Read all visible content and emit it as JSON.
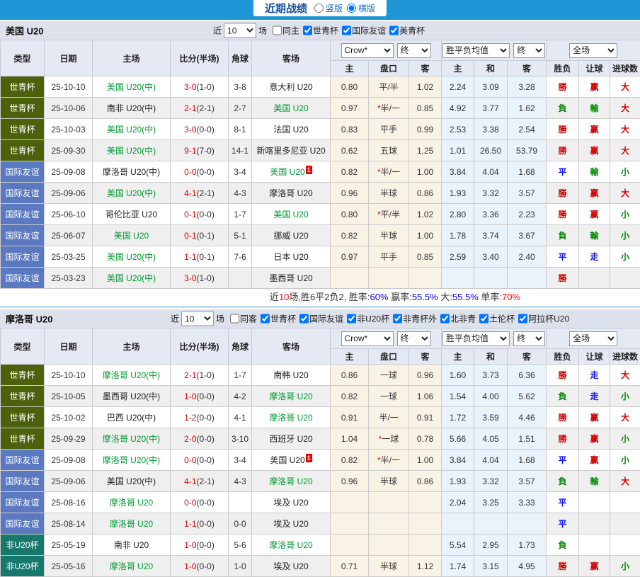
{
  "top_bar": {
    "title": "近期战绩",
    "radios": [
      {
        "label": "竖版",
        "selected": false
      },
      {
        "label": "横版",
        "selected": true
      }
    ]
  },
  "columns": {
    "type": "类型",
    "date": "日期",
    "home": "主场",
    "score": "比分(半场)",
    "corner": "角球",
    "away": "客场",
    "o_home": "主",
    "handicap": "盘口",
    "o_away": "客",
    "win": "主",
    "draw": "和",
    "lose": "客",
    "result": "胜负",
    "hcp_result": "让球",
    "goals": "进球数"
  },
  "odds_selects": {
    "bookmaker": "Crow*",
    "final_a": "终",
    "avg": "胜平负均值",
    "final_b": "终",
    "scope": "全场"
  },
  "colors": {
    "topbar_blue": "#1c96d4",
    "worldcup_green": "#4c610b",
    "friendly_blue": "#5b79c0",
    "nonu20_teal": "#17796d",
    "team_green": "#009933",
    "score_red": "#e80000",
    "win_red": "#d40000",
    "lose_green": "#008800",
    "draw_blue": "#1212ee"
  },
  "sections": [
    {
      "team": "美国 U20",
      "filter": {
        "near": "近",
        "count": "10",
        "unit": "场",
        "same": "同主",
        "cups": [
          "世青杯",
          "国际友谊",
          "美青杯"
        ]
      },
      "rows": [
        {
          "t": "世青杯",
          "tc": "wc",
          "dt": "25-10-10",
          "hm": "美国 U20(中)",
          "hg": true,
          "hsup": "",
          "ft": "3-0",
          "ht": "(1-0)",
          "cn": "3-8",
          "aw": "意大利 U20",
          "ag": false,
          "asup": "",
          "o1": "0.80",
          "hcp": "平/半",
          "o2": "1.02",
          "w": "2.24",
          "d": "3.09",
          "l": "3.28",
          "rs": "勝",
          "rsc": "r",
          "hr": "赢",
          "hrc": "r",
          "gl": "大",
          "glc": "r"
        },
        {
          "t": "世青杯",
          "tc": "wc",
          "dt": "25-10-06",
          "hm": "南非 U20(中)",
          "hg": false,
          "hsup": "",
          "ft": "2-1",
          "ht": "(2-1)",
          "cn": "2-7",
          "aw": "美国 U20",
          "ag": true,
          "asup": "",
          "o1": "0.97",
          "hcp": "*半/一",
          "o2": "0.85",
          "w": "4.92",
          "d": "3.77",
          "l": "1.62",
          "rs": "負",
          "rsc": "g",
          "hr": "輸",
          "hrc": "g",
          "gl": "大",
          "glc": "r"
        },
        {
          "t": "世青杯",
          "tc": "wc",
          "dt": "25-10-03",
          "hm": "美国 U20(中)",
          "hg": true,
          "hsup": "",
          "ft": "3-0",
          "ht": "(0-0)",
          "cn": "8-1",
          "aw": "法国 U20",
          "ag": false,
          "asup": "",
          "o1": "0.83",
          "hcp": "平手",
          "o2": "0.99",
          "w": "2.53",
          "d": "3.38",
          "l": "2.54",
          "rs": "勝",
          "rsc": "r",
          "hr": "赢",
          "hrc": "r",
          "gl": "大",
          "glc": "r"
        },
        {
          "t": "世青杯",
          "tc": "wc",
          "dt": "25-09-30",
          "hm": "美国 U20(中)",
          "hg": true,
          "hsup": "",
          "ft": "9-1",
          "ht": "(7-0)",
          "cn": "14-1",
          "aw": "新喀里多尼亚 U20",
          "ag": false,
          "asup": "",
          "o1": "0.62",
          "hcp": "五球",
          "o2": "1.25",
          "w": "1.01",
          "d": "26.50",
          "l": "53.79",
          "rs": "勝",
          "rsc": "r",
          "hr": "赢",
          "hrc": "r",
          "gl": "大",
          "glc": "r"
        },
        {
          "t": "国际友谊",
          "tc": "fr",
          "dt": "25-09-08",
          "hm": "摩洛哥 U20(中)",
          "hg": false,
          "hsup": "",
          "ft": "0-0",
          "ht": "(0-0)",
          "cn": "3-4",
          "aw": "美国 U20",
          "ag": true,
          "asup": "1",
          "o1": "0.82",
          "hcp": "*半/一",
          "o2": "1.00",
          "w": "3.84",
          "d": "4.04",
          "l": "1.68",
          "rs": "平",
          "rsc": "b",
          "hr": "輸",
          "hrc": "g",
          "gl": "小",
          "glc": "g"
        },
        {
          "t": "国际友谊",
          "tc": "fr",
          "dt": "25-09-06",
          "hm": "美国 U20(中)",
          "hg": true,
          "hsup": "",
          "ft": "4-1",
          "ht": "(2-1)",
          "cn": "4-3",
          "aw": "摩洛哥 U20",
          "ag": false,
          "asup": "",
          "o1": "0.96",
          "hcp": "半球",
          "o2": "0.86",
          "w": "1.93",
          "d": "3.32",
          "l": "3.57",
          "rs": "勝",
          "rsc": "r",
          "hr": "赢",
          "hrc": "r",
          "gl": "大",
          "glc": "r"
        },
        {
          "t": "国际友谊",
          "tc": "fr",
          "dt": "25-06-10",
          "hm": "哥伦比亚 U20",
          "hg": false,
          "hsup": "",
          "ft": "0-1",
          "ht": "(0-0)",
          "cn": "1-7",
          "aw": "美国 U20",
          "ag": true,
          "asup": "",
          "o1": "0.80",
          "hcp": "*平/半",
          "o2": "1.02",
          "w": "2.80",
          "d": "3.36",
          "l": "2.23",
          "rs": "勝",
          "rsc": "r",
          "hr": "赢",
          "hrc": "r",
          "gl": "小",
          "glc": "g"
        },
        {
          "t": "国际友谊",
          "tc": "fr",
          "dt": "25-06-07",
          "hm": "美国 U20",
          "hg": true,
          "hsup": "",
          "ft": "0-1",
          "ht": "(0-1)",
          "cn": "5-1",
          "aw": "挪威 U20",
          "ag": false,
          "asup": "",
          "o1": "0.82",
          "hcp": "半球",
          "o2": "1.00",
          "w": "1.78",
          "d": "3.74",
          "l": "3.67",
          "rs": "負",
          "rsc": "g",
          "hr": "輸",
          "hrc": "g",
          "gl": "小",
          "glc": "g"
        },
        {
          "t": "国际友谊",
          "tc": "fr",
          "dt": "25-03-25",
          "hm": "美国 U20(中)",
          "hg": true,
          "hsup": "",
          "ft": "1-1",
          "ht": "(0-1)",
          "cn": "7-6",
          "aw": "日本 U20",
          "ag": false,
          "asup": "",
          "o1": "0.97",
          "hcp": "平手",
          "o2": "0.85",
          "w": "2.59",
          "d": "3.40",
          "l": "2.40",
          "rs": "平",
          "rsc": "b",
          "hr": "走",
          "hrc": "b",
          "gl": "小",
          "glc": "g"
        },
        {
          "t": "国际友谊",
          "tc": "fr",
          "dt": "25-03-23",
          "hm": "美国 U20(中)",
          "hg": true,
          "hsup": "",
          "ft": "3-0",
          "ht": "(1-0)",
          "cn": "",
          "aw": "墨西哥 U20",
          "ag": false,
          "asup": "",
          "o1": "",
          "hcp": "",
          "o2": "",
          "w": "",
          "d": "",
          "l": "",
          "rs": "勝",
          "rsc": "r",
          "hr": "",
          "hrc": "",
          "gl": "",
          "glc": ""
        }
      ],
      "summary": [
        {
          "t": "近",
          "c": "k"
        },
        {
          "t": "10",
          "c": "r"
        },
        {
          "t": "场,胜6平2负2, 胜率:",
          "c": "k"
        },
        {
          "t": "60%",
          "c": "b"
        },
        {
          "t": " 赢率:",
          "c": "k"
        },
        {
          "t": "55.5%",
          "c": "b"
        },
        {
          "t": " 大:",
          "c": "k"
        },
        {
          "t": "55.5%",
          "c": "b"
        },
        {
          "t": " 单率:",
          "c": "k"
        },
        {
          "t": "70%",
          "c": "r"
        }
      ]
    },
    {
      "team": "摩洛哥 U20",
      "filter": {
        "near": "近",
        "count": "10",
        "unit": "场",
        "same": "同客",
        "cups": [
          "世青杯",
          "国际友谊",
          "非U20杯",
          "非青杯外",
          "北非青",
          "土伦杯",
          "阿拉杯U20"
        ]
      },
      "rows": [
        {
          "t": "世青杯",
          "tc": "wc",
          "dt": "25-10-10",
          "hm": "摩洛哥 U20(中)",
          "hg": true,
          "hsup": "",
          "ft": "2-1",
          "ht": "(1-0)",
          "cn": "1-7",
          "aw": "南韩 U20",
          "ag": false,
          "asup": "",
          "o1": "0.86",
          "hcp": "一球",
          "o2": "0.96",
          "w": "1.60",
          "d": "3.73",
          "l": "6.36",
          "rs": "勝",
          "rsc": "r",
          "hr": "走",
          "hrc": "b",
          "gl": "大",
          "glc": "r"
        },
        {
          "t": "世青杯",
          "tc": "wc",
          "dt": "25-10-05",
          "hm": "墨西哥 U20(中)",
          "hg": false,
          "hsup": "",
          "ft": "1-0",
          "ht": "(0-0)",
          "cn": "4-2",
          "aw": "摩洛哥 U20",
          "ag": true,
          "asup": "",
          "o1": "0.82",
          "hcp": "一球",
          "o2": "1.06",
          "w": "1.54",
          "d": "4.00",
          "l": "5.62",
          "rs": "負",
          "rsc": "g",
          "hr": "走",
          "hrc": "b",
          "gl": "小",
          "glc": "g"
        },
        {
          "t": "世青杯",
          "tc": "wc",
          "dt": "25-10-02",
          "hm": "巴西 U20(中)",
          "hg": false,
          "hsup": "",
          "ft": "1-2",
          "ht": "(0-0)",
          "cn": "4-1",
          "aw": "摩洛哥 U20",
          "ag": true,
          "asup": "",
          "o1": "0.91",
          "hcp": "半/一",
          "o2": "0.91",
          "w": "1.72",
          "d": "3.59",
          "l": "4.46",
          "rs": "勝",
          "rsc": "r",
          "hr": "赢",
          "hrc": "r",
          "gl": "大",
          "glc": "r"
        },
        {
          "t": "世青杯",
          "tc": "wc",
          "dt": "25-09-29",
          "hm": "摩洛哥 U20(中)",
          "hg": true,
          "hsup": "",
          "ft": "2-0",
          "ht": "(0-0)",
          "cn": "3-10",
          "aw": "西班牙 U20",
          "ag": false,
          "asup": "",
          "o1": "1.04",
          "hcp": "*一球",
          "o2": "0.78",
          "w": "5.66",
          "d": "4.05",
          "l": "1.51",
          "rs": "勝",
          "rsc": "r",
          "hr": "赢",
          "hrc": "r",
          "gl": "小",
          "glc": "g"
        },
        {
          "t": "国际友谊",
          "tc": "fr",
          "dt": "25-09-08",
          "hm": "摩洛哥 U20(中)",
          "hg": true,
          "hsup": "",
          "ft": "0-0",
          "ht": "(0-0)",
          "cn": "3-4",
          "aw": "美国 U20",
          "ag": false,
          "asup": "1",
          "o1": "0.82",
          "hcp": "*半/一",
          "o2": "1.00",
          "w": "3.84",
          "d": "4.04",
          "l": "1.68",
          "rs": "平",
          "rsc": "b",
          "hr": "赢",
          "hrc": "r",
          "gl": "小",
          "glc": "g"
        },
        {
          "t": "国际友谊",
          "tc": "fr",
          "dt": "25-09-06",
          "hm": "美国 U20(中)",
          "hg": false,
          "hsup": "",
          "ft": "4-1",
          "ht": "(2-1)",
          "cn": "4-3",
          "aw": "摩洛哥 U20",
          "ag": true,
          "asup": "",
          "o1": "0.96",
          "hcp": "半球",
          "o2": "0.86",
          "w": "1.93",
          "d": "3.32",
          "l": "3.57",
          "rs": "負",
          "rsc": "g",
          "hr": "輸",
          "hrc": "g",
          "gl": "大",
          "glc": "r"
        },
        {
          "t": "国际友谊",
          "tc": "fr",
          "dt": "25-08-16",
          "hm": "摩洛哥 U20",
          "hg": true,
          "hsup": "",
          "ft": "0-0",
          "ht": "(0-0)",
          "cn": "",
          "aw": "埃及 U20",
          "ag": false,
          "asup": "",
          "o1": "",
          "hcp": "",
          "o2": "",
          "w": "2.04",
          "d": "3.25",
          "l": "3.33",
          "rs": "平",
          "rsc": "b",
          "hr": "",
          "hrc": "",
          "gl": "",
          "glc": ""
        },
        {
          "t": "国际友谊",
          "tc": "fr",
          "dt": "25-08-14",
          "hm": "摩洛哥 U20",
          "hg": true,
          "hsup": "",
          "ft": "1-1",
          "ht": "(0-0)",
          "cn": "0-0",
          "aw": "埃及 U20",
          "ag": false,
          "asup": "",
          "o1": "",
          "hcp": "",
          "o2": "",
          "w": "",
          "d": "",
          "l": "",
          "rs": "平",
          "rsc": "b",
          "hr": "",
          "hrc": "",
          "gl": "",
          "glc": ""
        },
        {
          "t": "非U20杯",
          "tc": "nu",
          "dt": "25-05-19",
          "hm": "南非 U20",
          "hg": false,
          "hsup": "",
          "ft": "1-0",
          "ht": "(0-0)",
          "cn": "5-6",
          "aw": "摩洛哥 U20",
          "ag": true,
          "asup": "",
          "o1": "",
          "hcp": "",
          "o2": "",
          "w": "5.54",
          "d": "2.95",
          "l": "1.73",
          "rs": "負",
          "rsc": "g",
          "hr": "",
          "hrc": "",
          "gl": "",
          "glc": ""
        },
        {
          "t": "非U20杯",
          "tc": "nu",
          "dt": "25-05-16",
          "hm": "摩洛哥 U20",
          "hg": true,
          "hsup": "",
          "ft": "1-0",
          "ht": "(0-0)",
          "cn": "1-0",
          "aw": "埃及 U20",
          "ag": false,
          "asup": "",
          "o1": "0.71",
          "hcp": "半球",
          "o2": "1.12",
          "w": "1.74",
          "d": "3.15",
          "l": "4.95",
          "rs": "勝",
          "rsc": "r",
          "hr": "赢",
          "hrc": "r",
          "gl": "小",
          "glc": "g"
        }
      ],
      "summary": []
    }
  ]
}
